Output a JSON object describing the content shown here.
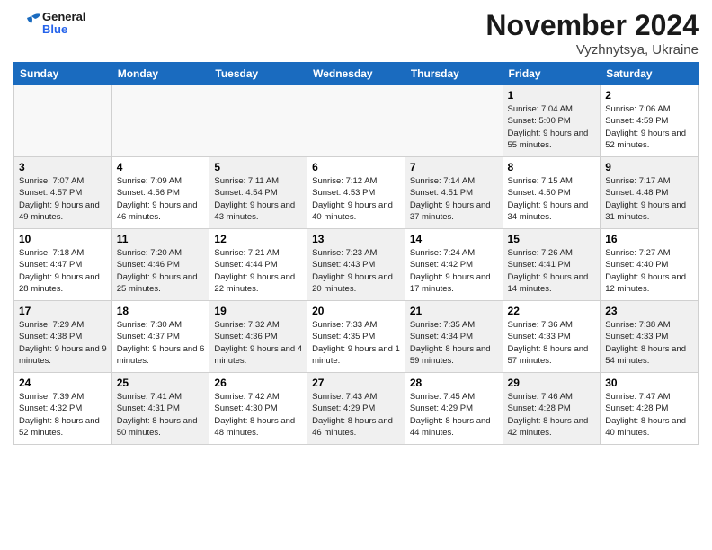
{
  "header": {
    "logo_general": "General",
    "logo_blue": "Blue",
    "month_title": "November 2024",
    "location": "Vyzhnytsya, Ukraine"
  },
  "weekdays": [
    "Sunday",
    "Monday",
    "Tuesday",
    "Wednesday",
    "Thursday",
    "Friday",
    "Saturday"
  ],
  "weeks": [
    [
      {
        "day": "",
        "empty": true
      },
      {
        "day": "",
        "empty": true
      },
      {
        "day": "",
        "empty": true
      },
      {
        "day": "",
        "empty": true
      },
      {
        "day": "",
        "empty": true
      },
      {
        "day": "1",
        "sunrise": "7:04 AM",
        "sunset": "5:00 PM",
        "daylight": "9 hours and 55 minutes."
      },
      {
        "day": "2",
        "sunrise": "7:06 AM",
        "sunset": "4:59 PM",
        "daylight": "9 hours and 52 minutes."
      }
    ],
    [
      {
        "day": "3",
        "sunrise": "7:07 AM",
        "sunset": "4:57 PM",
        "daylight": "9 hours and 49 minutes."
      },
      {
        "day": "4",
        "sunrise": "7:09 AM",
        "sunset": "4:56 PM",
        "daylight": "9 hours and 46 minutes."
      },
      {
        "day": "5",
        "sunrise": "7:11 AM",
        "sunset": "4:54 PM",
        "daylight": "9 hours and 43 minutes."
      },
      {
        "day": "6",
        "sunrise": "7:12 AM",
        "sunset": "4:53 PM",
        "daylight": "9 hours and 40 minutes."
      },
      {
        "day": "7",
        "sunrise": "7:14 AM",
        "sunset": "4:51 PM",
        "daylight": "9 hours and 37 minutes."
      },
      {
        "day": "8",
        "sunrise": "7:15 AM",
        "sunset": "4:50 PM",
        "daylight": "9 hours and 34 minutes."
      },
      {
        "day": "9",
        "sunrise": "7:17 AM",
        "sunset": "4:48 PM",
        "daylight": "9 hours and 31 minutes."
      }
    ],
    [
      {
        "day": "10",
        "sunrise": "7:18 AM",
        "sunset": "4:47 PM",
        "daylight": "9 hours and 28 minutes."
      },
      {
        "day": "11",
        "sunrise": "7:20 AM",
        "sunset": "4:46 PM",
        "daylight": "9 hours and 25 minutes."
      },
      {
        "day": "12",
        "sunrise": "7:21 AM",
        "sunset": "4:44 PM",
        "daylight": "9 hours and 22 minutes."
      },
      {
        "day": "13",
        "sunrise": "7:23 AM",
        "sunset": "4:43 PM",
        "daylight": "9 hours and 20 minutes."
      },
      {
        "day": "14",
        "sunrise": "7:24 AM",
        "sunset": "4:42 PM",
        "daylight": "9 hours and 17 minutes."
      },
      {
        "day": "15",
        "sunrise": "7:26 AM",
        "sunset": "4:41 PM",
        "daylight": "9 hours and 14 minutes."
      },
      {
        "day": "16",
        "sunrise": "7:27 AM",
        "sunset": "4:40 PM",
        "daylight": "9 hours and 12 minutes."
      }
    ],
    [
      {
        "day": "17",
        "sunrise": "7:29 AM",
        "sunset": "4:38 PM",
        "daylight": "9 hours and 9 minutes."
      },
      {
        "day": "18",
        "sunrise": "7:30 AM",
        "sunset": "4:37 PM",
        "daylight": "9 hours and 6 minutes."
      },
      {
        "day": "19",
        "sunrise": "7:32 AM",
        "sunset": "4:36 PM",
        "daylight": "9 hours and 4 minutes."
      },
      {
        "day": "20",
        "sunrise": "7:33 AM",
        "sunset": "4:35 PM",
        "daylight": "9 hours and 1 minute."
      },
      {
        "day": "21",
        "sunrise": "7:35 AM",
        "sunset": "4:34 PM",
        "daylight": "8 hours and 59 minutes."
      },
      {
        "day": "22",
        "sunrise": "7:36 AM",
        "sunset": "4:33 PM",
        "daylight": "8 hours and 57 minutes."
      },
      {
        "day": "23",
        "sunrise": "7:38 AM",
        "sunset": "4:33 PM",
        "daylight": "8 hours and 54 minutes."
      }
    ],
    [
      {
        "day": "24",
        "sunrise": "7:39 AM",
        "sunset": "4:32 PM",
        "daylight": "8 hours and 52 minutes."
      },
      {
        "day": "25",
        "sunrise": "7:41 AM",
        "sunset": "4:31 PM",
        "daylight": "8 hours and 50 minutes."
      },
      {
        "day": "26",
        "sunrise": "7:42 AM",
        "sunset": "4:30 PM",
        "daylight": "8 hours and 48 minutes."
      },
      {
        "day": "27",
        "sunrise": "7:43 AM",
        "sunset": "4:29 PM",
        "daylight": "8 hours and 46 minutes."
      },
      {
        "day": "28",
        "sunrise": "7:45 AM",
        "sunset": "4:29 PM",
        "daylight": "8 hours and 44 minutes."
      },
      {
        "day": "29",
        "sunrise": "7:46 AM",
        "sunset": "4:28 PM",
        "daylight": "8 hours and 42 minutes."
      },
      {
        "day": "30",
        "sunrise": "7:47 AM",
        "sunset": "4:28 PM",
        "daylight": "8 hours and 40 minutes."
      }
    ]
  ]
}
